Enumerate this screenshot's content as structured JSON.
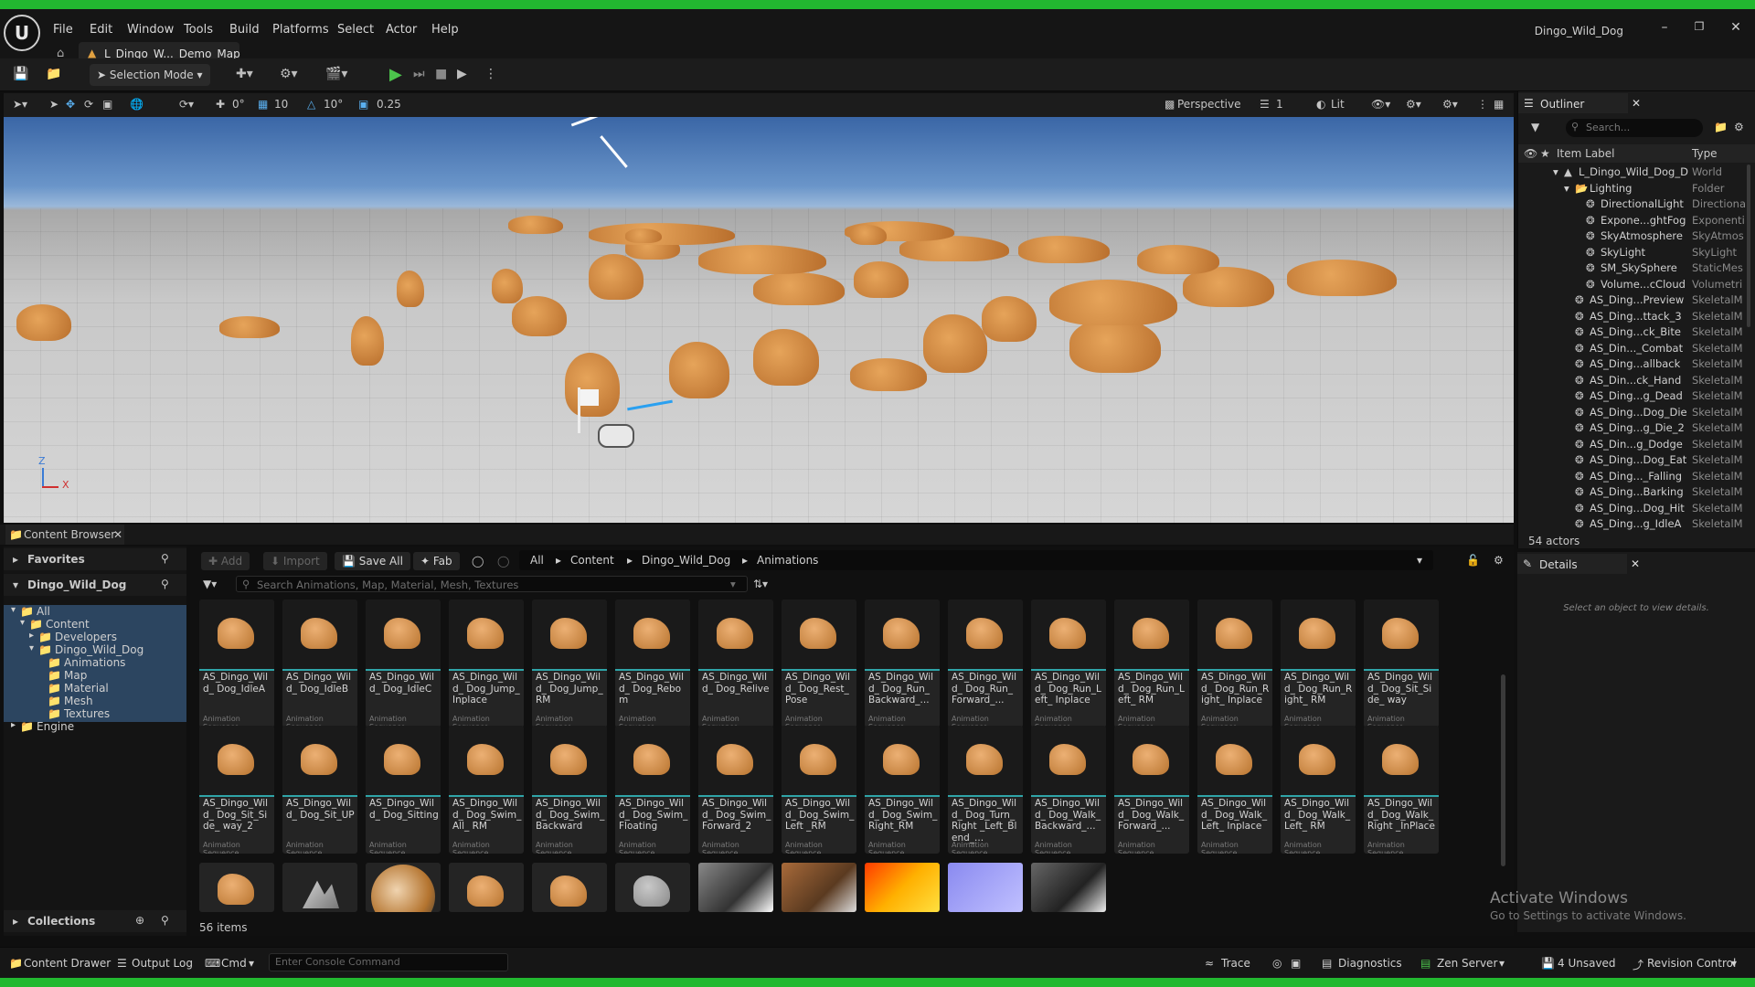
{
  "window": {
    "title": "Dingo_Wild_Dog",
    "logo": "U",
    "controls": [
      "–",
      "❐",
      "✕"
    ]
  },
  "menu": [
    "File",
    "Edit",
    "Window",
    "Tools",
    "Build",
    "Platforms",
    "Select",
    "Actor",
    "Help"
  ],
  "doc_tab": {
    "label": "L_Dingo_W..._Demo_Map"
  },
  "toolbar": {
    "selection_mode": "Selection Mode"
  },
  "viewport_bar": {
    "rot_snap": "0°",
    "grid": "10",
    "angle": "10°",
    "scale": "0.25",
    "perspective": "Perspective",
    "layers": "1",
    "lit": "Lit"
  },
  "axis": {
    "z": "Z",
    "x": "X"
  },
  "outliner": {
    "title": "Outliner",
    "search_placeholder": "Search...",
    "col_label": "Item Label",
    "col_type": "Type",
    "rows": [
      {
        "label": "L_Dingo_Wild_Dog_D",
        "type": "World",
        "indent": 0
      },
      {
        "label": "Lighting",
        "type": "Folder",
        "indent": 1
      },
      {
        "label": "DirectionalLight",
        "type": "Directiona",
        "indent": 2
      },
      {
        "label": "Expone...ghtFog",
        "type": "Exponenti",
        "indent": 2
      },
      {
        "label": "SkyAtmosphere",
        "type": "SkyAtmos",
        "indent": 2
      },
      {
        "label": "SkyLight",
        "type": "SkyLight",
        "indent": 2
      },
      {
        "label": "SM_SkySphere",
        "type": "StaticMes",
        "indent": 2
      },
      {
        "label": "Volume...cCloud",
        "type": "Volumetri",
        "indent": 2
      },
      {
        "label": "AS_Ding...Preview",
        "type": "SkeletalM",
        "indent": 1
      },
      {
        "label": "AS_Ding...ttack_3",
        "type": "SkeletalM",
        "indent": 1
      },
      {
        "label": "AS_Ding...ck_Bite",
        "type": "SkeletalM",
        "indent": 1
      },
      {
        "label": "AS_Din..._Combat",
        "type": "SkeletalM",
        "indent": 1
      },
      {
        "label": "AS_Ding...allback",
        "type": "SkeletalM",
        "indent": 1
      },
      {
        "label": "AS_Din...ck_Hand",
        "type": "SkeletalM",
        "indent": 1
      },
      {
        "label": "AS_Ding...g_Dead",
        "type": "SkeletalM",
        "indent": 1
      },
      {
        "label": "AS_Ding...Dog_Die",
        "type": "SkeletalM",
        "indent": 1
      },
      {
        "label": "AS_Ding...g_Die_2",
        "type": "SkeletalM",
        "indent": 1
      },
      {
        "label": "AS_Din...g_Dodge",
        "type": "SkeletalM",
        "indent": 1
      },
      {
        "label": "AS_Ding...Dog_Eat",
        "type": "SkeletalM",
        "indent": 1
      },
      {
        "label": "AS_Ding..._Falling",
        "type": "SkeletalM",
        "indent": 1
      },
      {
        "label": "AS_Ding...Barking",
        "type": "SkeletalM",
        "indent": 1
      },
      {
        "label": "AS_Ding...Dog_Hit",
        "type": "SkeletalM",
        "indent": 1
      },
      {
        "label": "AS_Ding...g_IdleA",
        "type": "SkeletalM",
        "indent": 1
      }
    ],
    "count": "54 actors"
  },
  "details": {
    "title": "Details",
    "empty": "Select an object to view details."
  },
  "content_browser": {
    "tab": "Content Browser",
    "favorites": "Favorites",
    "root": "Dingo_Wild_Dog",
    "tree": [
      {
        "label": "All",
        "indent": 0
      },
      {
        "label": "Content",
        "indent": 1
      },
      {
        "label": "Developers",
        "indent": 2
      },
      {
        "label": "Dingo_Wild_Dog",
        "indent": 2
      },
      {
        "label": "Animations",
        "indent": 3
      },
      {
        "label": "Map",
        "indent": 3
      },
      {
        "label": "Material",
        "indent": 3
      },
      {
        "label": "Mesh",
        "indent": 3
      },
      {
        "label": "Textures",
        "indent": 3
      },
      {
        "label": "Engine",
        "indent": 0
      }
    ],
    "collections": "Collections",
    "buttons": {
      "add": "Add",
      "import": "Import",
      "save_all": "Save All",
      "fab": "Fab"
    },
    "breadcrumbs": [
      "All",
      "Content",
      "Dingo_Wild_Dog",
      "Animations"
    ],
    "search_placeholder": "Search Animations, Map, Material, Mesh, Textures",
    "asset_type": "Animation Sequence",
    "assets_row1": [
      "AS_Dingo_Wild_ Dog_IdleA",
      "AS_Dingo_Wild_ Dog_IdleB",
      "AS_Dingo_Wild_ Dog_IdleC",
      "AS_Dingo_Wild_ Dog_Jump_ Inplace",
      "AS_Dingo_Wild_ Dog_Jump_RM",
      "AS_Dingo_Wild_ Dog_Rebom",
      "AS_Dingo_Wild_ Dog_Relive",
      "AS_Dingo_Wild_ Dog_Rest_Pose",
      "AS_Dingo_Wild_ Dog_Run_ Backward_...",
      "AS_Dingo_Wild_ Dog_Run_ Forward_...",
      "AS_Dingo_Wild_ Dog_Run_Left_ Inplace",
      "AS_Dingo_Wild_ Dog_Run_Left_ RM",
      "AS_Dingo_Wild_ Dog_Run_Right_ Inplace",
      "AS_Dingo_Wild_ Dog_Run_Right_ RM",
      "AS_Dingo_Wild_ Dog_Sit_Side_ way"
    ],
    "assets_row2": [
      "AS_Dingo_Wild_ Dog_Sit_Side_ way_2",
      "AS_Dingo_Wild_ Dog_Sit_UP",
      "AS_Dingo_Wild_ Dog_Sitting",
      "AS_Dingo_Wild_ Dog_Swim_All_ RM",
      "AS_Dingo_Wild_ Dog_Swim_ Backward",
      "AS_Dingo_Wild_ Dog_Swim_ Floating",
      "AS_Dingo_Wild_ Dog_Swim_ Forward_2",
      "AS_Dingo_Wild_ Dog_Swim_Left _RM",
      "AS_Dingo_Wild_ Dog_Swim_ Right_RM",
      "AS_Dingo_Wild_ Dog_Turn_Right _Left_Blend_...",
      "AS_Dingo_Wild_ Dog_Walk_ Backward_...",
      "AS_Dingo_Wild_ Dog_Walk_ Forward_...",
      "AS_Dingo_Wild_ Dog_Walk_Left_ Inplace",
      "AS_Dingo_Wild_ Dog_Walk_Left_ RM",
      "AS_Dingo_Wild_ Dog_Walk_Right _InPlace"
    ],
    "items_count": "56 items"
  },
  "activation": {
    "title": "Activate Windows",
    "subtitle": "Go to Settings to activate Windows."
  },
  "statusbar": {
    "content_drawer": "Content Drawer",
    "output_log": "Output Log",
    "cmd": "Cmd",
    "console_placeholder": "Enter Console Command",
    "trace": "Trace",
    "diagnostics": "Diagnostics",
    "zen_server": "Zen Server",
    "unsaved": "4 Unsaved",
    "revision_control": "Revision Control"
  },
  "colors": {
    "accent_green": "#22b830",
    "play_green": "#4cc44c",
    "selection": "#2c4560",
    "folder": "#c9a24a"
  }
}
